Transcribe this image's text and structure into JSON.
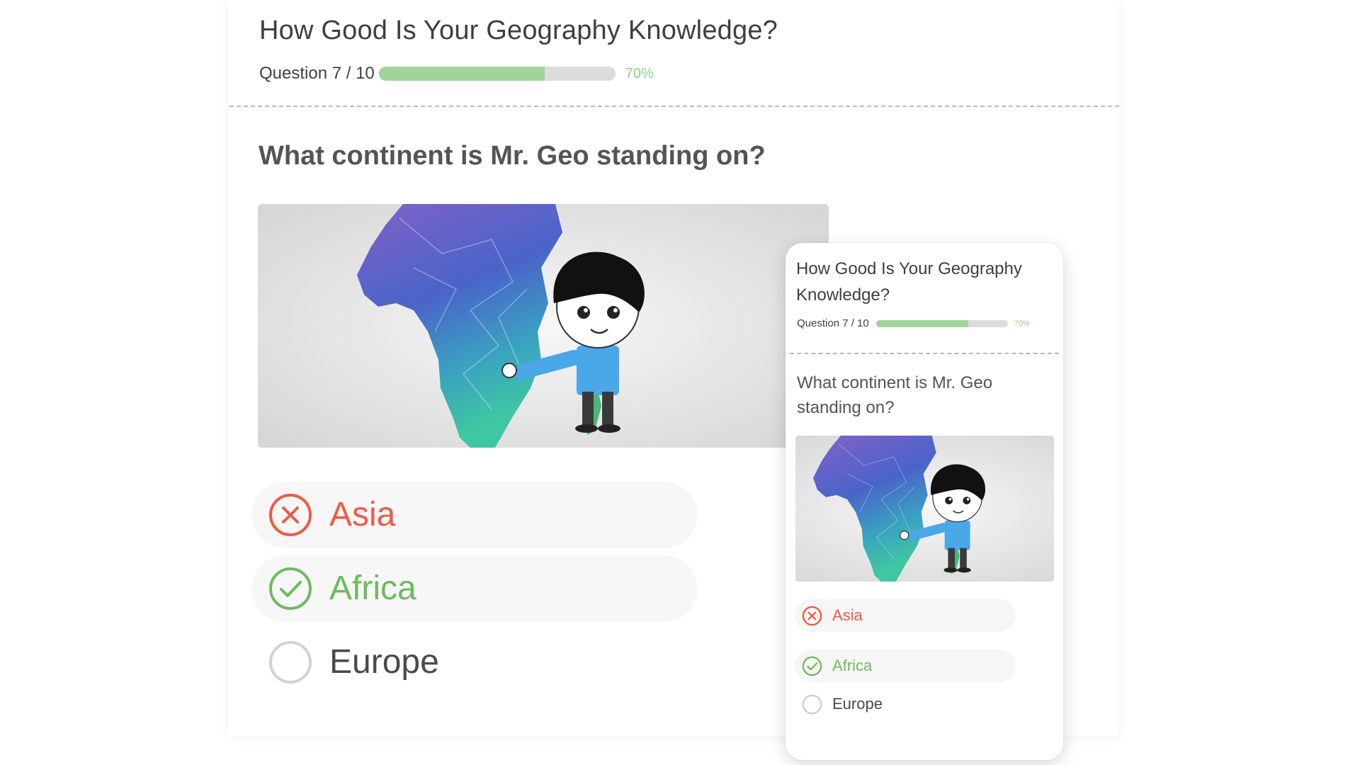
{
  "quiz": {
    "title": "How Good Is Your Geography Knowledge?",
    "progress": {
      "label": "Question 7 / 10",
      "percent_text": "70%",
      "value": 0.7
    },
    "question": "What continent is Mr. Geo standing on?",
    "image_alt": "Mr. Geo cartoon character standing next to a map of Africa",
    "options": [
      {
        "label": "Asia",
        "state": "wrong",
        "icon": "x-circle-icon"
      },
      {
        "label": "Africa",
        "state": "correct",
        "icon": "check-circle-icon"
      },
      {
        "label": "Europe",
        "state": "unselected",
        "icon": "empty-radio-icon"
      }
    ]
  },
  "colors": {
    "wrong": "#ef5a48",
    "correct": "#6dbc5e",
    "progress_fill": "#9fd59a",
    "progress_track": "#dcdcdc"
  }
}
